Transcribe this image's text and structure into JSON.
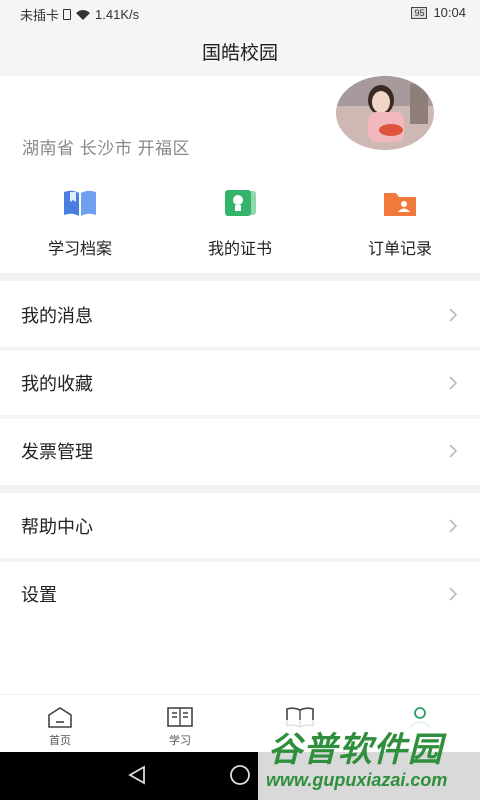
{
  "status_bar": {
    "carrier": "未插卡",
    "speed": "1.41K/s",
    "battery": "95",
    "time": "10:04"
  },
  "header": {
    "title": "国皓校园"
  },
  "profile": {
    "location": "湖南省 长沙市 开福区"
  },
  "quick_actions": [
    {
      "label": "学习档案",
      "icon": "book-icon",
      "color": "#4a7fe0"
    },
    {
      "label": "我的证书",
      "icon": "certificate-icon",
      "color": "#34b36b"
    },
    {
      "label": "订单记录",
      "icon": "order-folder-icon",
      "color": "#f07a3c"
    }
  ],
  "menu": [
    {
      "label": "我的消息"
    },
    {
      "label": "我的收藏"
    },
    {
      "label": "发票管理"
    },
    {
      "label": "帮助中心"
    },
    {
      "label": "设置"
    }
  ],
  "tabs": [
    {
      "label": "首页",
      "icon": "home-icon"
    },
    {
      "label": "学习",
      "icon": "study-icon"
    },
    {
      "label": "",
      "icon": "course-book-icon"
    },
    {
      "label": "",
      "icon": "profile-icon",
      "active": true
    }
  ],
  "watermark": {
    "cn": "谷普软件园",
    "en": "www.gupuxiazai.com"
  }
}
